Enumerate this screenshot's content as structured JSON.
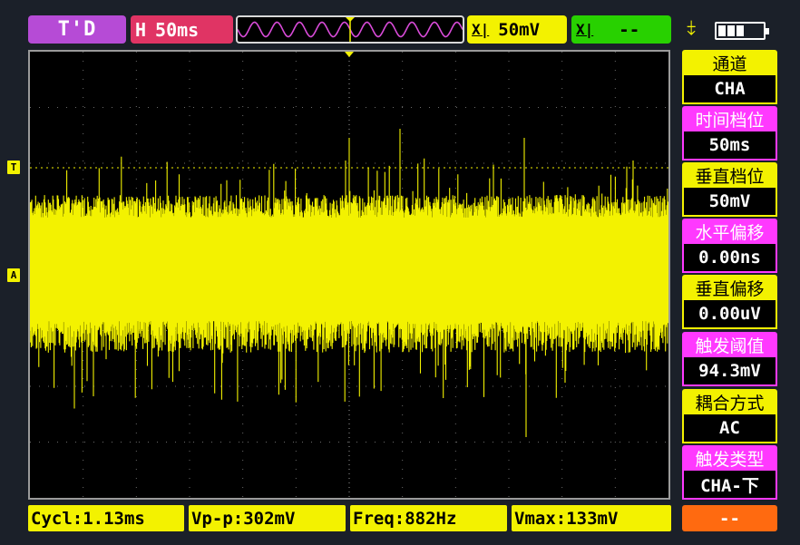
{
  "top_bar": {
    "mode": "T'D",
    "timebase_prefix": "H",
    "timebase": "50ms",
    "channel_a": {
      "symbol": "X|",
      "value": "50mV"
    },
    "channel_b": {
      "symbol": "X|",
      "value": "--"
    },
    "battery_level_cells": 3
  },
  "screen": {
    "trigger_marker": "T",
    "channel_marker": "A",
    "colors": {
      "trace": "#f3f200",
      "grid": "#6a6a6a",
      "background": "#000000"
    }
  },
  "menu": [
    {
      "label": "通道",
      "value": "CHA"
    },
    {
      "label": "时间档位",
      "value": "50ms"
    },
    {
      "label": "垂直档位",
      "value": "50mV"
    },
    {
      "label": "水平偏移",
      "value": "0.00ns"
    },
    {
      "label": "垂直偏移",
      "value": "0.00uV"
    },
    {
      "label": "触发阈值",
      "value": "94.3mV"
    },
    {
      "label": "耦合方式",
      "value": "AC"
    },
    {
      "label": "触发类型",
      "value": "CHA-下"
    }
  ],
  "measurements": [
    "Cycl:1.13ms",
    "Vp-p:302mV",
    "Freq:882Hz",
    "Vmax:133mV"
  ],
  "soft_button": "--"
}
